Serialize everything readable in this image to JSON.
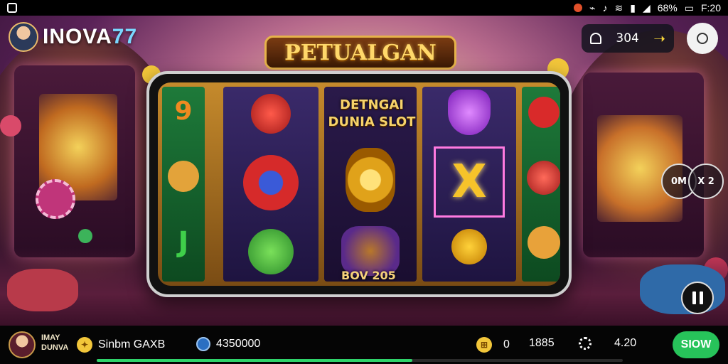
{
  "status_bar": {
    "battery": "68%",
    "time": "F:20",
    "icons": [
      "record-dot-icon",
      "usb-icon",
      "mute-icon",
      "wifi-icon",
      "signal-icon",
      "battery-icon"
    ]
  },
  "header": {
    "brand_main": "INOVA",
    "brand_num": "77",
    "coin_value": "304"
  },
  "game": {
    "title": "PETUALGAN",
    "inner_title_line1": "DETNGAI",
    "inner_title_line2": "DUNIA SLOT",
    "reel_caption": "BOV 205",
    "multiplier_left": "0M",
    "multiplier_right": "X 2"
  },
  "bottom_bar": {
    "player_line1": "IMAY",
    "player_line2": "DUNVA",
    "label": "Sinbm GAXB",
    "balance": "4350000",
    "bet": "0",
    "win": "1885",
    "value": "4.20",
    "spin_label": "SIOW",
    "progress": 0.6
  },
  "colors": {
    "accent_green": "#27c35a",
    "gold": "#e6b34a",
    "panel": "#050505"
  }
}
